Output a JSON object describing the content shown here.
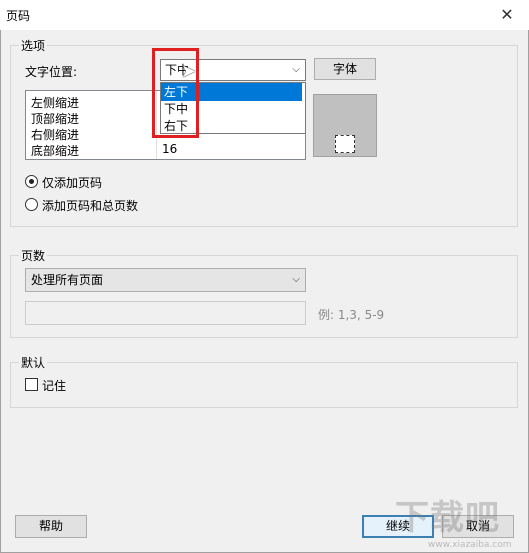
{
  "window": {
    "title": "页码",
    "close_glyph": "✕"
  },
  "options": {
    "group_label": "选项",
    "text_position_label": "文字位置:",
    "text_position_value": "下中",
    "font_button": "字体",
    "dropdown_items": [
      "左下",
      "下中",
      "右下"
    ],
    "indents": [
      {
        "label": "左侧缩进",
        "value": ""
      },
      {
        "label": "顶部缩进",
        "value": ""
      },
      {
        "label": "右侧缩进",
        "value": ""
      },
      {
        "label": "底部缩进",
        "value": "16"
      }
    ],
    "radio_page_only": "仅添加页码",
    "radio_page_total": "添加页码和总页数"
  },
  "pages": {
    "group_label": "页数",
    "range_select_value": "处理所有页面",
    "range_input_value": "",
    "range_hint": "例: 1,3, 5-9"
  },
  "defaults": {
    "group_label": "默认",
    "remember_label": "记住"
  },
  "footer": {
    "help_button": "帮助",
    "continue_button": "继续",
    "cancel_button": "取消"
  },
  "watermark": {
    "text": "下载吧",
    "url": "www.xiazaiba.com"
  }
}
